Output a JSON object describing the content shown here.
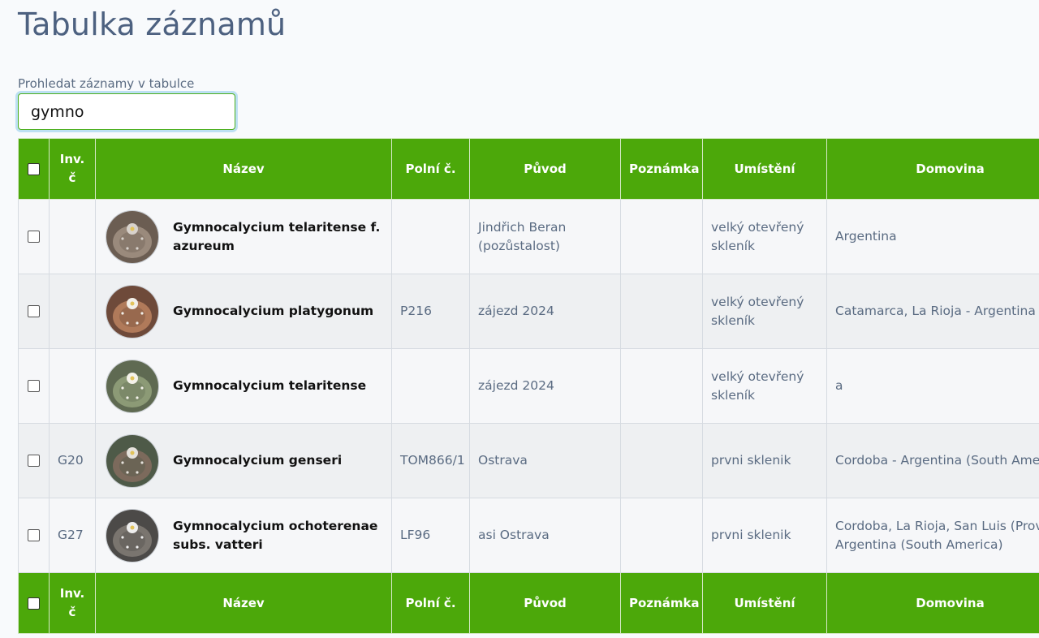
{
  "page": {
    "title": "Tabulka záznamů"
  },
  "search": {
    "label": "Prohledat záznamy v tabulce",
    "value": "gymno"
  },
  "table": {
    "columns": {
      "inv": "Inv. č",
      "nazev": "Název",
      "polni": "Polní č.",
      "puvod": "Původ",
      "poznamka": "Poznámka",
      "umisteni": "Umístění",
      "domovina": "Domovina"
    },
    "rows": [
      {
        "inv": "",
        "nazev": "Gymnocalycium telaritense f. azureum",
        "polni": "",
        "puvod": "Jindřich Beran (pozůstalost)",
        "poznamka": "",
        "umisteni": "velký otevřený skleník",
        "domovina": "Argentina",
        "thumb_icon": "cactus-photo"
      },
      {
        "inv": "",
        "nazev": "Gymnocalycium platygonum",
        "polni": "P216",
        "puvod": "zájezd 2024",
        "poznamka": "",
        "umisteni": "velký otevřený skleník",
        "domovina": "Catamarca, La Rioja - Argentina (So",
        "thumb_icon": "cactus-photo"
      },
      {
        "inv": "",
        "nazev": "Gymnocalycium telaritense",
        "polni": "",
        "puvod": "zájezd 2024",
        "poznamka": "",
        "umisteni": "velký otevřený skleník",
        "domovina": "a",
        "thumb_icon": "cactus-photo"
      },
      {
        "inv": "G20",
        "nazev": "Gymnocalycium genseri",
        "polni": "TOM866/1",
        "puvod": "Ostrava",
        "poznamka": "",
        "umisteni": "prvni sklenik",
        "domovina": "Cordoba - Argentina (South Americ",
        "thumb_icon": "cactus-photo"
      },
      {
        "inv": "G27",
        "nazev": "Gymnocalycium ochoterenae subs. vatteri",
        "polni": "LF96",
        "puvod": "asi Ostrava",
        "poznamka": "",
        "umisteni": "prvni sklenik",
        "domovina": "Cordoba, La Rioja, San Luis (Provin Argentina (South America)",
        "thumb_icon": "cactus-photo"
      }
    ]
  },
  "colors": {
    "header_green": "#4ca80a",
    "title": "#4d6180",
    "input_border": "#4caf1c",
    "input_focus_ring": "#bde0f3"
  }
}
